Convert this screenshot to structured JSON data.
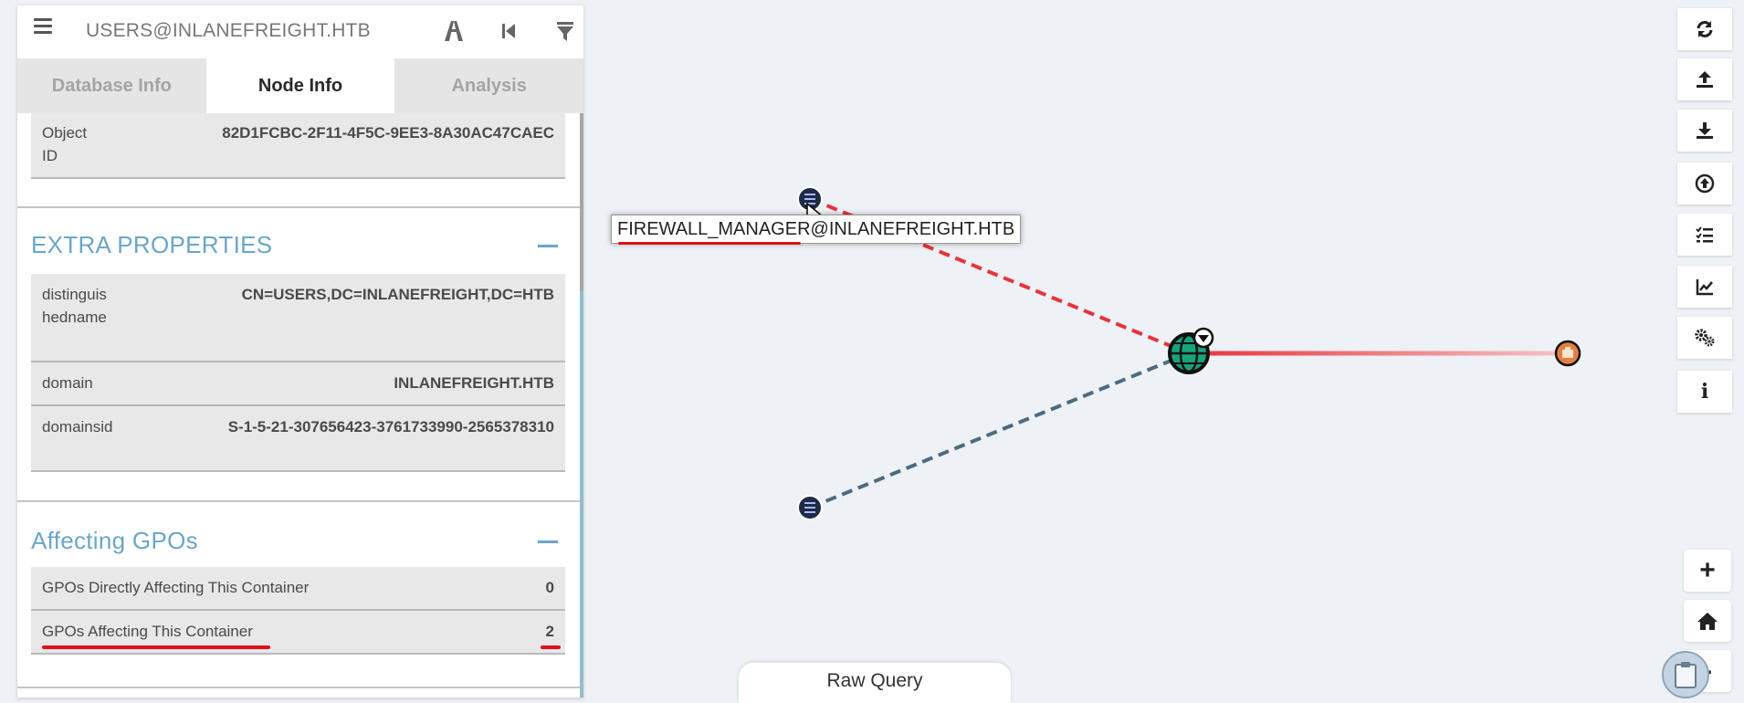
{
  "search": {
    "value": "USERS@INLANEFREIGHT.HTB"
  },
  "toolbar_left": {
    "icons": [
      "pathfinding-icon",
      "back-icon",
      "filter-icon"
    ]
  },
  "tabs": [
    {
      "label": "Database Info",
      "active": false
    },
    {
      "label": "Node Info",
      "active": true
    },
    {
      "label": "Analysis",
      "active": false
    }
  ],
  "node_props": {
    "object_id_key": "Object ID",
    "object_id_value": "82D1FCBC-2F11-4F5C-9EE3-8A30AC47CAEC"
  },
  "extra_properties": {
    "title": "EXTRA PROPERTIES",
    "rows": [
      {
        "key": "distinguishedname",
        "value": "CN=USERS,DC=INLANEFREIGHT,DC=HTB"
      },
      {
        "key": "domain",
        "value": "INLANEFREIGHT.HTB"
      },
      {
        "key": "domainsid",
        "value": "S-1-5-21-307656423-3761733990-2565378310"
      }
    ]
  },
  "affecting_gpos": {
    "title": "Affecting GPOs",
    "rows": [
      {
        "key": "GPOs Directly Affecting This Container",
        "value": "0"
      },
      {
        "key": "GPOs Affecting This Container",
        "value": "2"
      }
    ]
  },
  "graph": {
    "node_label": "FIREWALL_MANAGER@INLANEFREIGHT.HTB",
    "colors": {
      "edge_red": "#e8333c",
      "edge_blue": "#4e6b7d",
      "domain_green": "#17a37a",
      "ou_orange": "#e37f42",
      "group_navy": "#1f2a44"
    }
  },
  "right_toolbar": {
    "icons": [
      "refresh-icon",
      "upload-icon",
      "download-icon",
      "circle-up-icon",
      "task-list-icon",
      "chart-line-icon",
      "settings-icon"
    ],
    "info_label": "i"
  },
  "zoom": {
    "in_label": "+",
    "out_label": "-"
  },
  "raw_query": {
    "label": "Raw Query"
  }
}
